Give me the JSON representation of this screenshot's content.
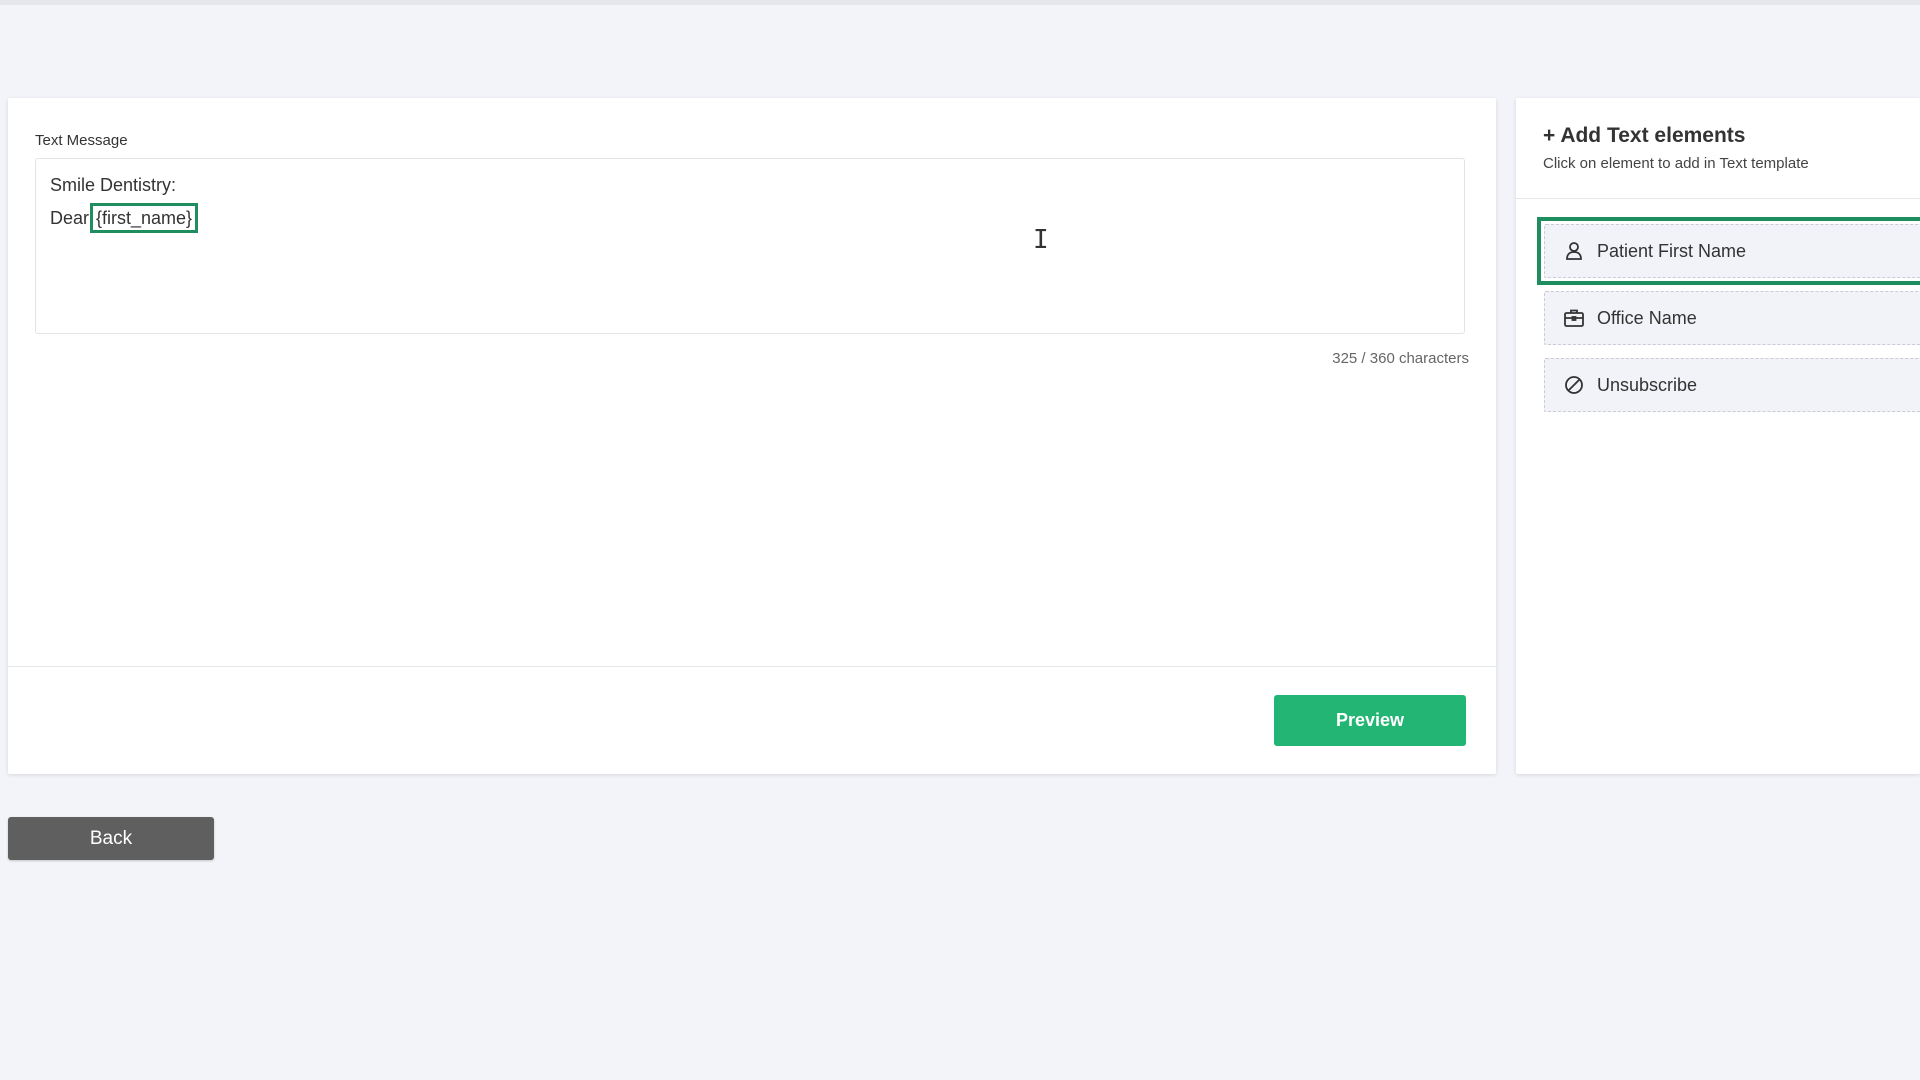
{
  "editor": {
    "label": "Text Message",
    "lines": {
      "line1": "Smile Dentistry:",
      "line2_prefix": "Dear",
      "line2_token": "{first_name}"
    },
    "char_count": "325 / 360 characters",
    "preview_label": "Preview"
  },
  "elements_panel": {
    "title": "+ Add Text elements",
    "subtitle": "Click on element to add in Text template",
    "items": [
      {
        "label": "Patient First Name",
        "icon": "person-icon"
      },
      {
        "label": "Office Name",
        "icon": "briefcase-icon"
      },
      {
        "label": "Unsubscribe",
        "icon": "ban-icon"
      }
    ]
  },
  "nav": {
    "back_label": "Back"
  },
  "colors": {
    "accent": "#22b573",
    "highlight": "#1e8e5e",
    "back_button": "#5f5f5f"
  }
}
